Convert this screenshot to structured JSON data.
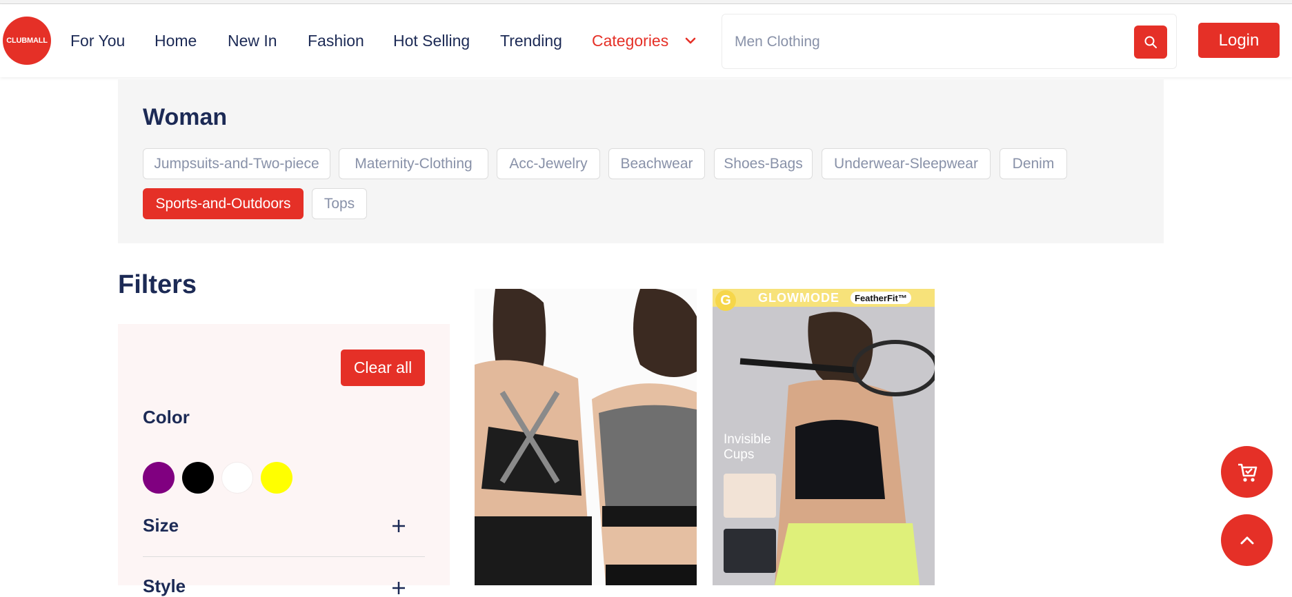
{
  "header": {
    "logo_text": "CLUBMALL",
    "nav": [
      "For You",
      "Home",
      "New In",
      "Fashion",
      "Hot Selling",
      "Trending",
      "Categories"
    ],
    "search_placeholder": "Men Clothing",
    "login_label": "Login"
  },
  "categories": {
    "title": "Woman",
    "chips": [
      "Jumpsuits-and-Two-piece",
      "Maternity-Clothing",
      "Acc-Jewelry",
      "Beachwear",
      "Shoes-Bags",
      "Underwear-Sleepwear",
      "Denim",
      "Sports-and-Outdoors",
      "Tops"
    ],
    "active_chip": "Sports-and-Outdoors"
  },
  "filters": {
    "title": "Filters",
    "clear_label": "Clear all",
    "color_label": "Color",
    "colors": [
      "#800080",
      "#000000",
      "#ffffff",
      "#ffff00"
    ],
    "size_label": "Size",
    "style_label": "Style"
  },
  "products": [
    {
      "image": "sports-bra-front-back-photo"
    },
    {
      "image": "tennis-sports-bra-photo",
      "brand": "GLOWMODE",
      "badge": "FeatherFit™",
      "caption": "Invisible Cups"
    }
  ],
  "colors": {
    "accent": "#e53027",
    "navy": "#1c2a55",
    "panel": "#f5f5f5"
  }
}
